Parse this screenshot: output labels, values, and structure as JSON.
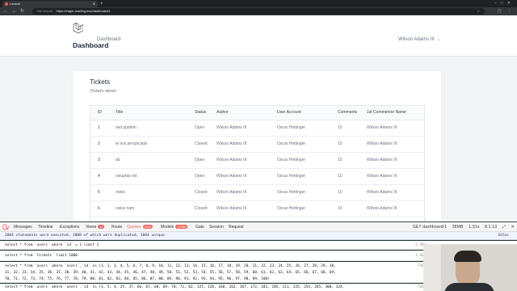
{
  "browser": {
    "tab_title": "Laravel",
    "not_secure": "Not secure",
    "url": "https://eager-loading.test/dashboard/1"
  },
  "app": {
    "nav_link": "Dashboard",
    "user_name": "Wilson Adams III",
    "page_title": "Dashboard"
  },
  "card": {
    "title": "Tickets",
    "subtitle": "Tickets demo",
    "columns": [
      "ID",
      "Title",
      "Status",
      "Author",
      "User Account",
      "Comments",
      "1st Commentor Name"
    ],
    "rows": [
      {
        "id": "1",
        "title": "sed quidem",
        "status": "Open",
        "author": "Wilson Adams III",
        "account": "Oscar Hettinger",
        "comments": "10",
        "commentor": "Wilson Adams III"
      },
      {
        "id": "2",
        "title": "et nisi perspiciatis",
        "status": "Closed",
        "author": "Wilson Adams III",
        "account": "Oscar Hettinger",
        "comments": "10",
        "commentor": "Wilson Adams III"
      },
      {
        "id": "3",
        "title": "ab",
        "status": "Open",
        "author": "Wilson Adams III",
        "account": "Oscar Hettinger",
        "comments": "10",
        "commentor": "Wilson Adams III"
      },
      {
        "id": "4",
        "title": "voluptas est",
        "status": "Open",
        "author": "Wilson Adams III",
        "account": "Oscar Hettinger",
        "comments": "10",
        "commentor": "Wilson Adams III"
      },
      {
        "id": "5",
        "title": "nobis",
        "status": "Closed",
        "author": "Wilson Adams III",
        "account": "Oscar Hettinger",
        "comments": "10",
        "commentor": "Wilson Adams III"
      },
      {
        "id": "6",
        "title": "natus nam",
        "status": "Closed",
        "author": "Wilson Adams III",
        "account": "Oscar Hettinger",
        "comments": "10",
        "commentor": "Wilson Adams III"
      }
    ]
  },
  "debugbar": {
    "tabs": {
      "messages": "Messages",
      "timeline": "Timeline",
      "exceptions": "Exceptions",
      "views": "Views",
      "views_count": "11",
      "route": "Route",
      "queries": "Queries",
      "queries_count": "2004",
      "models": "Models",
      "models_count": "12056",
      "gate": "Gate",
      "session": "Session",
      "request": "Request"
    },
    "right": {
      "request": "GET dashboard/1",
      "memory": "36MB",
      "time": "1.91s",
      "php": "8.1.13"
    },
    "message": "2004 statements were executed, 1000 of which were duplicated, 1004 unique",
    "message_right": "605ms",
    "statements": [
      {
        "sql": "select * from `users` where `id` = 1 limit 1",
        "meta": "2.49ms"
      },
      {
        "sql": "select * from `tickets` limit 1000",
        "meta": "1.42ms"
      },
      {
        "sql": "select * from `users` where `users`.`id` in (1, 2, 3, 4, 5, 6, 7, 8, 9, 10, 11, 12, 13, 14, 15, 16, 17, 18, 19, 20, 21, 22, 23, 24, 25, 26, 27, 28, 29, 30,",
        "meta": "736ms"
      },
      {
        "sql": "31, 32, 33, 34, 35, 36, 37, 38, 39, 40, 41, 42, 43, 44, 45, 46, 47, 48, 49, 50, 51, 52, 53, 54, 55, 56, 57, 58, 59, 60, 61, 62, 63, 64, 65, 66, 67, 68, 69,",
        "meta": ""
      },
      {
        "sql": "70, 71, 72, 73, 74, 75, 76, 77, 78, 79, 80, 81, 82, 83, 84, 85, 86, 87, 88, 89, 90, 91, 92, 93, 94, 95, 96, 97, 98, 99, 100)",
        "meta": ""
      },
      {
        "sql": "select * from `users` where `users`.`id` in (3, 5, 4, 25, 37, 66, 67, 68, 69, 70, 72, 82, 125, 128, 160, 162, 167, 172, 181, 205, 211, 225, 254, 265, 300, 324,",
        "meta": "736ms"
      }
    ]
  }
}
